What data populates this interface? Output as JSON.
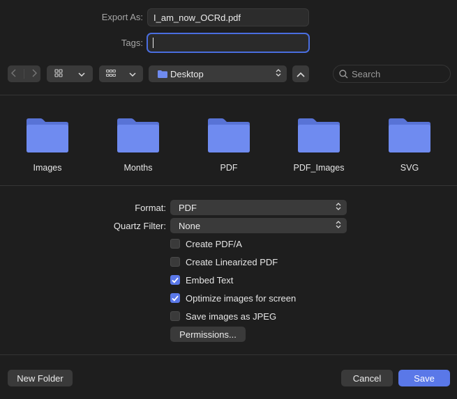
{
  "export": {
    "label": "Export As:",
    "value": "I_am_now_OCRd.pdf"
  },
  "tags": {
    "label": "Tags:",
    "value": ""
  },
  "toolbar": {
    "location": "Desktop",
    "search_placeholder": "Search"
  },
  "folders": [
    {
      "name": "Images"
    },
    {
      "name": "Months"
    },
    {
      "name": "PDF"
    },
    {
      "name": "PDF_Images"
    },
    {
      "name": "SVG"
    }
  ],
  "options": {
    "format_label": "Format:",
    "format_value": "PDF",
    "quartz_label": "Quartz Filter:",
    "quartz_value": "None",
    "checkboxes": [
      {
        "label": "Create PDF/A",
        "checked": false
      },
      {
        "label": "Create Linearized PDF",
        "checked": false
      },
      {
        "label": "Embed Text",
        "checked": true
      },
      {
        "label": "Optimize images for screen",
        "checked": true
      },
      {
        "label": "Save images as JPEG",
        "checked": false
      }
    ],
    "permissions_label": "Permissions..."
  },
  "footer": {
    "new_folder_label": "New Folder",
    "cancel_label": "Cancel",
    "save_label": "Save"
  },
  "colors": {
    "accent": "#5a78e8",
    "folder": "#6f8bf0",
    "background": "#1e1e1e"
  }
}
